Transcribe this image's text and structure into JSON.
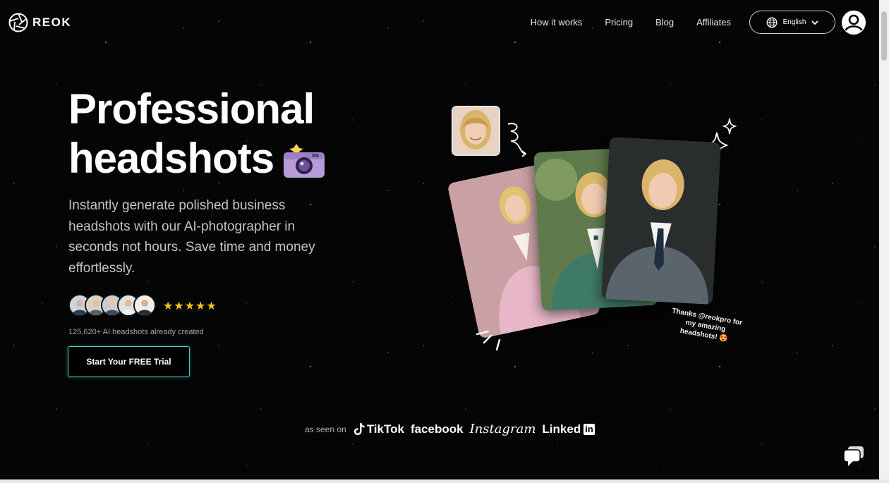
{
  "header": {
    "logo_text": "REOK",
    "nav": [
      {
        "label": "How it works"
      },
      {
        "label": "Pricing"
      },
      {
        "label": "Blog"
      },
      {
        "label": "Affiliates"
      }
    ],
    "language": "English"
  },
  "hero": {
    "title_line1": "Professional",
    "title_line2": "headshots",
    "description": "Instantly generate polished business headshots with our AI-photographer in seconds not hours. Save time and money effortlessly.",
    "rating_stars": "★★★★★",
    "rating_value": 5,
    "count_text": "125,620+ AI headshots already created",
    "cta_label": "Start Your FREE Trial"
  },
  "showcase": {
    "thanks_text": "Thanks @reokpro for my amazing headshots! 😍"
  },
  "seen_on": {
    "label": "as seen on",
    "brands": {
      "tiktok": "TikTok",
      "facebook": "facebook",
      "instagram": "Instagram",
      "linkedin_text": "Linked",
      "linkedin_box": "in"
    }
  },
  "colors": {
    "background": "#000000",
    "accent": "#4fd1c5",
    "star": "#f5c518",
    "text_muted": "#c4c4c4"
  },
  "icons": [
    "aperture-logo-icon",
    "globe-icon",
    "chevron-down-icon",
    "user-avatar-icon",
    "camera-icon",
    "arrow-curl-icon",
    "sparkle-icon",
    "burst-lines-icon",
    "tiktok-icon",
    "chat-bubble-icon"
  ]
}
